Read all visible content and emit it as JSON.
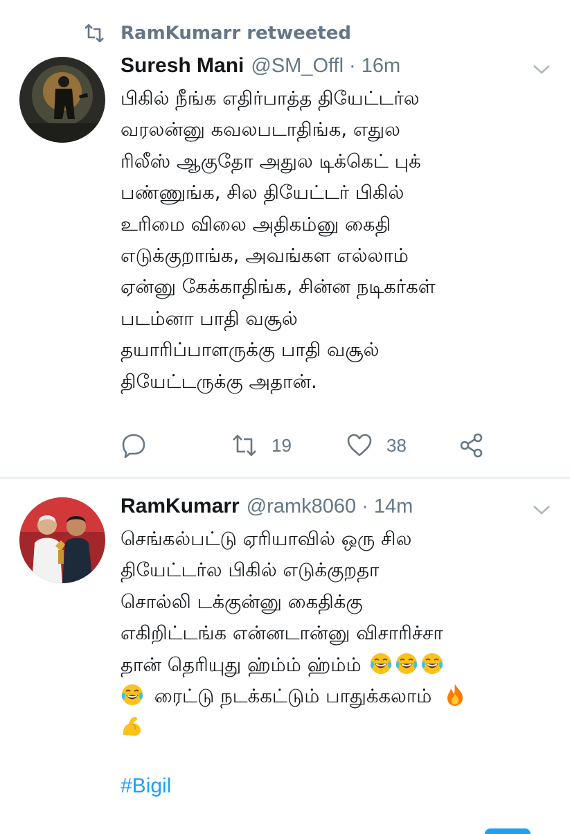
{
  "retweet_banner": {
    "text": "RamKumarr retweeted"
  },
  "tweets": [
    {
      "name": "Suresh Mani",
      "handle": "@SM_Offl",
      "separator": "·",
      "time": "16m",
      "lines": [
        "பிகில் நீங்க எதிர்பாத்த தியேட்டர்ல",
        "வரலன்னு கவலபடாதிங்க, எதுல",
        "ரிலீஸ் ஆகுதோ அதுல டிக்கெட் புக்",
        "பண்ணுங்க, சில தியேட்டர் பிகில்",
        "உரிமை விலை அதிகம்னு கைதி",
        "எடுக்குறாங்க, அவங்கள எல்லாம்",
        "ஏன்னு கேக்காதிங்க, சின்ன நடிகர்கள்",
        "படம்னா பாதி வசூல்",
        "தயாரிப்பாளருக்கு பாதி வசூல்",
        "தியேட்டருக்கு அதான்."
      ],
      "actions": {
        "retweets": "19",
        "likes": "38"
      }
    },
    {
      "name": "RamKumarr",
      "handle": "@ramk8060",
      "separator": "·",
      "time": "14m",
      "lines": [
        "செங்கல்பட்டு ஏரியாவில் ஒரு சில",
        "தியேட்டர்ல பிகில் எடுக்குறதா",
        "சொல்லி டக்குன்னு கைதிக்கு",
        "எகிறிட்டங்க என்னடான்னு விசாரிச்சா",
        "தான் தெரியுது ஹ்ம்ம் ஹ்ம்ம்",
        "ரைட்டு நடக்கட்டும் பாதுக்கலாம்"
      ],
      "hashtag": "#Bigil"
    }
  ],
  "icons": {
    "retweet": "retweet-icon",
    "reply": "reply-icon",
    "like": "heart-icon",
    "share": "share-icon",
    "caret": "chevron-down-icon",
    "emoji_laugh": "tears-of-joy-emoji",
    "emoji_fire": "fire-emoji",
    "emoji_muscle": "flexed-biceps-emoji"
  },
  "colors": {
    "text": "#14171a",
    "secondary": "#657786",
    "link": "#1da1f2",
    "divider": "#e6ecf0"
  }
}
